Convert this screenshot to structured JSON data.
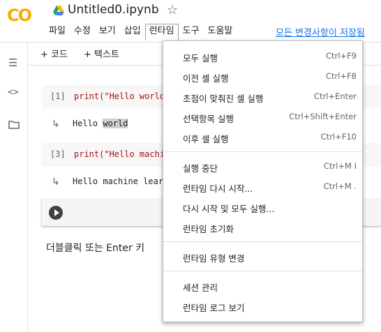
{
  "app": {
    "logo_text": "CO",
    "file_title": "Untitled0.ipynb",
    "star_icon": "star-outline-icon"
  },
  "menubar": {
    "items": [
      "파일",
      "수정",
      "보기",
      "삽입",
      "런타임",
      "도구",
      "도움말"
    ],
    "active_index": 4,
    "saved_status": "모든 변경사항이 저장됨"
  },
  "toolbar": {
    "code_label": "+ 코드",
    "text_label": "+ 텍스트"
  },
  "leftbar": {
    "icons": [
      "list-icon",
      "code-icon",
      "folder-icon"
    ]
  },
  "cells": [
    {
      "number": "[1]",
      "code": "print(\"Hello world",
      "output_plain": "Hello ",
      "output_highlight": "world"
    },
    {
      "number": "[3]",
      "code": "print(\"Hello machi",
      "output_plain": "Hello machine lear",
      "output_highlight": ""
    }
  ],
  "hint_text": "더블클릭 또는 Enter 키",
  "runtime_menu": {
    "groups": [
      [
        {
          "label": "모두 실행",
          "shortcut": "Ctrl+F9"
        },
        {
          "label": "이전 셀 실행",
          "shortcut": "Ctrl+F8"
        },
        {
          "label": "초점이 맞춰진 셀 실행",
          "shortcut": "Ctrl+Enter"
        },
        {
          "label": "선택항목 실행",
          "shortcut": "Ctrl+Shift+Enter"
        },
        {
          "label": "이후 셀 실행",
          "shortcut": "Ctrl+F10"
        }
      ],
      [
        {
          "label": "실행 중단",
          "shortcut": "Ctrl+M I"
        },
        {
          "label": "런타임 다시 시작...",
          "shortcut": "Ctrl+M ."
        },
        {
          "label": "다시 시작 및 모두 실행...",
          "shortcut": ""
        },
        {
          "label": "런타임 초기화",
          "shortcut": ""
        }
      ],
      [
        {
          "label": "런타임 유형 변경",
          "shortcut": ""
        }
      ],
      [
        {
          "label": "세션 관리",
          "shortcut": ""
        },
        {
          "label": "런타임 로그 보기",
          "shortcut": ""
        }
      ]
    ]
  },
  "colors": {
    "logo": "#f9ab00",
    "link": "#1a73e8",
    "code_string": "#aa1111"
  }
}
